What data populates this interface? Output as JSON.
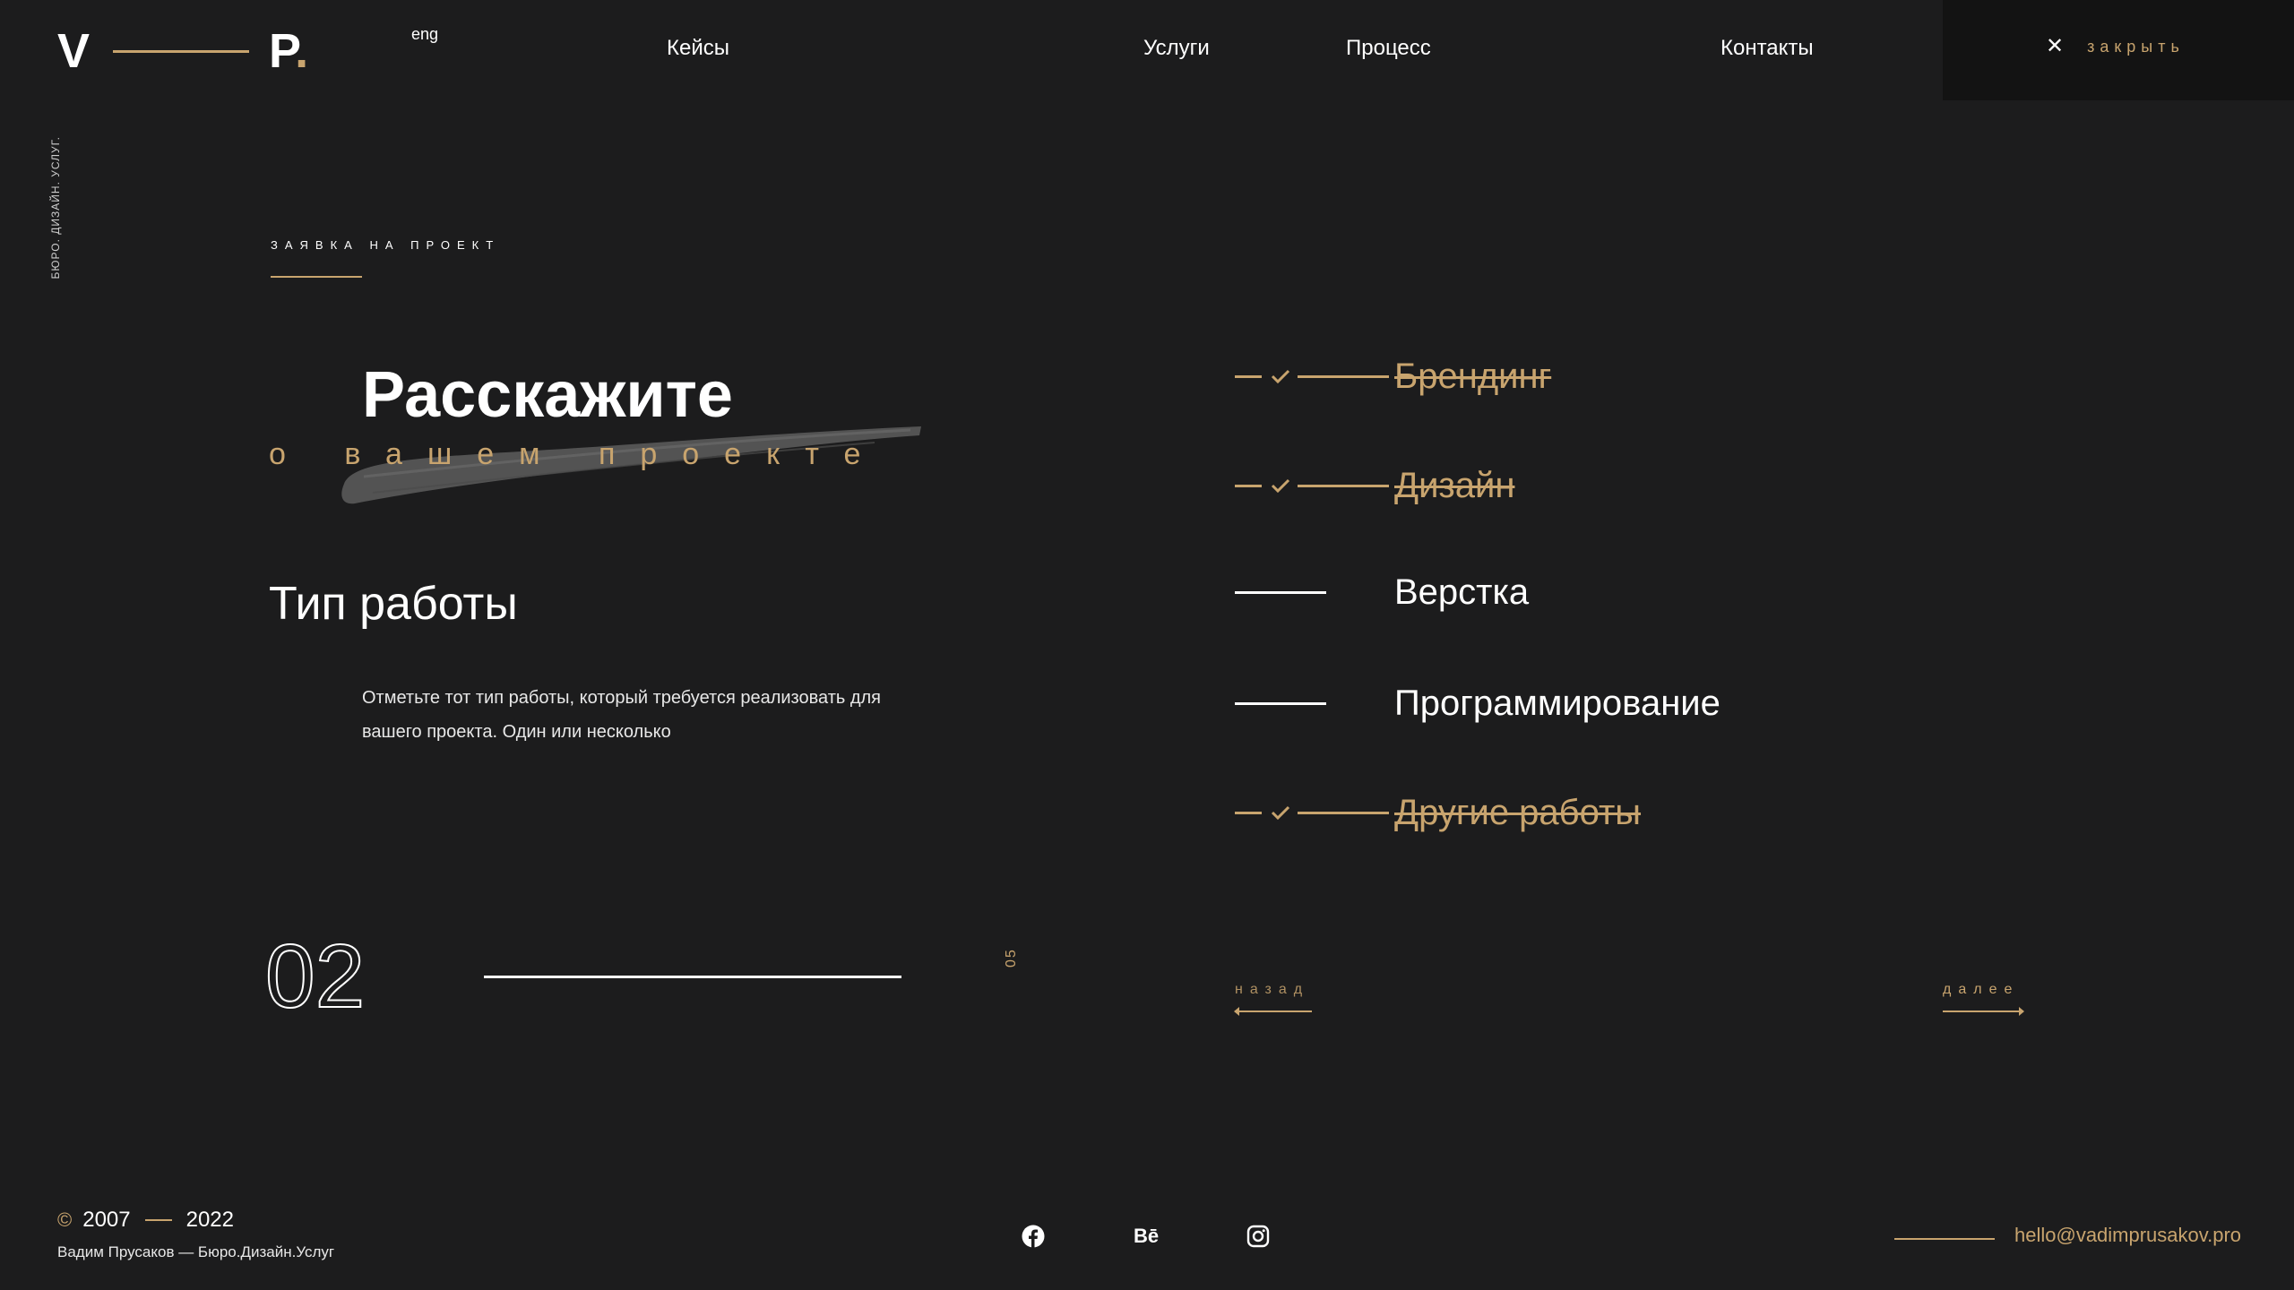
{
  "header": {
    "logo": {
      "left_letter": "V",
      "right_letter": "P",
      "dot": "."
    },
    "lang": "eng",
    "nav": [
      "Кейсы",
      "Услуги",
      "Процесс",
      "Контакты"
    ],
    "close_label": "закрыть"
  },
  "side_text": "БЮРО. ДИЗАЙН. УСЛУГ.",
  "form": {
    "kicker": "ЗАЯВКА НА ПРОЕКТ",
    "title": "Расскажите",
    "subtitle": "о вашем проекте",
    "section_title": "Тип работы",
    "description": "Отметьте тот тип работы, который требуется  реализовать для вашего проекта. Один или несколько",
    "step": "02",
    "step_total": "05",
    "options": [
      {
        "label": "Брендинг",
        "checked": true
      },
      {
        "label": "Дизайн",
        "checked": true
      },
      {
        "label": "Верстка",
        "checked": false
      },
      {
        "label": "Программирование",
        "checked": false
      },
      {
        "label": "Другие работы",
        "checked": true
      }
    ],
    "back_label": "назад",
    "next_label": "далее"
  },
  "footer": {
    "copyright_symbol": "©",
    "year_start": "2007",
    "year_end": "2022",
    "subline": "Вадим Прусаков — Бюро.Дизайн.Услуг",
    "social": [
      "facebook-icon",
      "behance-icon",
      "instagram-icon"
    ],
    "behance_text": "Bē",
    "email": "hello@vadimprusakov.pro"
  },
  "colors": {
    "background": "#1c1c1d",
    "accent": "#c8a46e",
    "text": "#ffffff",
    "panel": "#131313"
  }
}
